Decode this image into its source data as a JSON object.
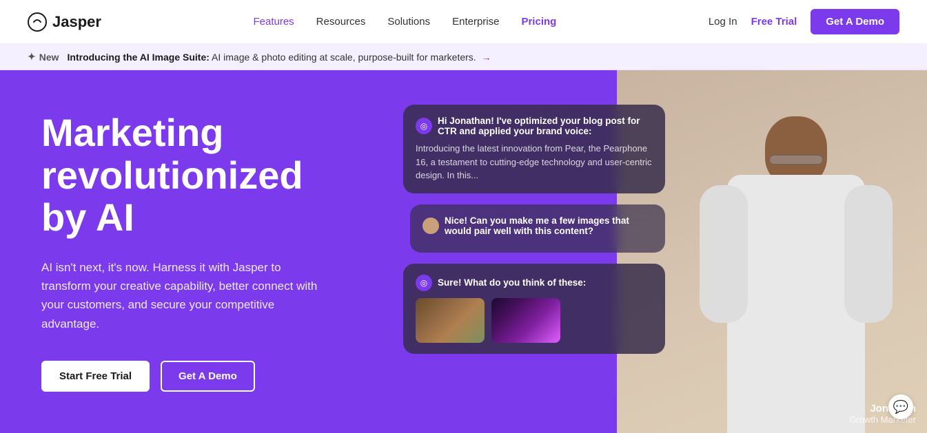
{
  "navbar": {
    "logo_text": "Jasper",
    "links": [
      {
        "label": "Features",
        "active": false
      },
      {
        "label": "Resources",
        "active": false
      },
      {
        "label": "Solutions",
        "active": false
      },
      {
        "label": "Enterprise",
        "active": false
      },
      {
        "label": "Pricing",
        "active": true
      }
    ],
    "login_label": "Log In",
    "free_trial_label": "Free Trial",
    "get_demo_label": "Get A Demo"
  },
  "announcement": {
    "new_label": "New",
    "title_bold": "Introducing the AI Image Suite:",
    "title_text": " AI image & photo editing at scale, purpose-built for marketers.",
    "arrow": "→"
  },
  "hero": {
    "title": "Marketing revolutionized by AI",
    "subtitle": "AI isn't next, it's now. Harness it with Jasper to transform your creative capability, better connect with your customers, and secure your competitive advantage.",
    "btn_trial": "Start Free Trial",
    "btn_demo": "Get A Demo"
  },
  "chat": {
    "bubble1": {
      "header": "Hi Jonathan! I've optimized your blog post for CTR and applied your brand voice:",
      "body": "Introducing the latest innovation from Pear, the Pearphone 16, a testament to cutting-edge technology and user-centric design. In this..."
    },
    "bubble2": {
      "header": "Nice! Can you make me a few images that would pair well with this content?"
    },
    "bubble3": {
      "header": "Sure! What do you think of these:"
    }
  },
  "person": {
    "name": "Jonathan",
    "role": "Growth Marketer"
  },
  "icons": {
    "sparkle": "✦",
    "jasper_ai": "◎",
    "arrow_right": "→",
    "chat_bubble": "💬"
  },
  "colors": {
    "purple": "#7c3aed",
    "white": "#ffffff",
    "dark": "#1a1a1a"
  }
}
